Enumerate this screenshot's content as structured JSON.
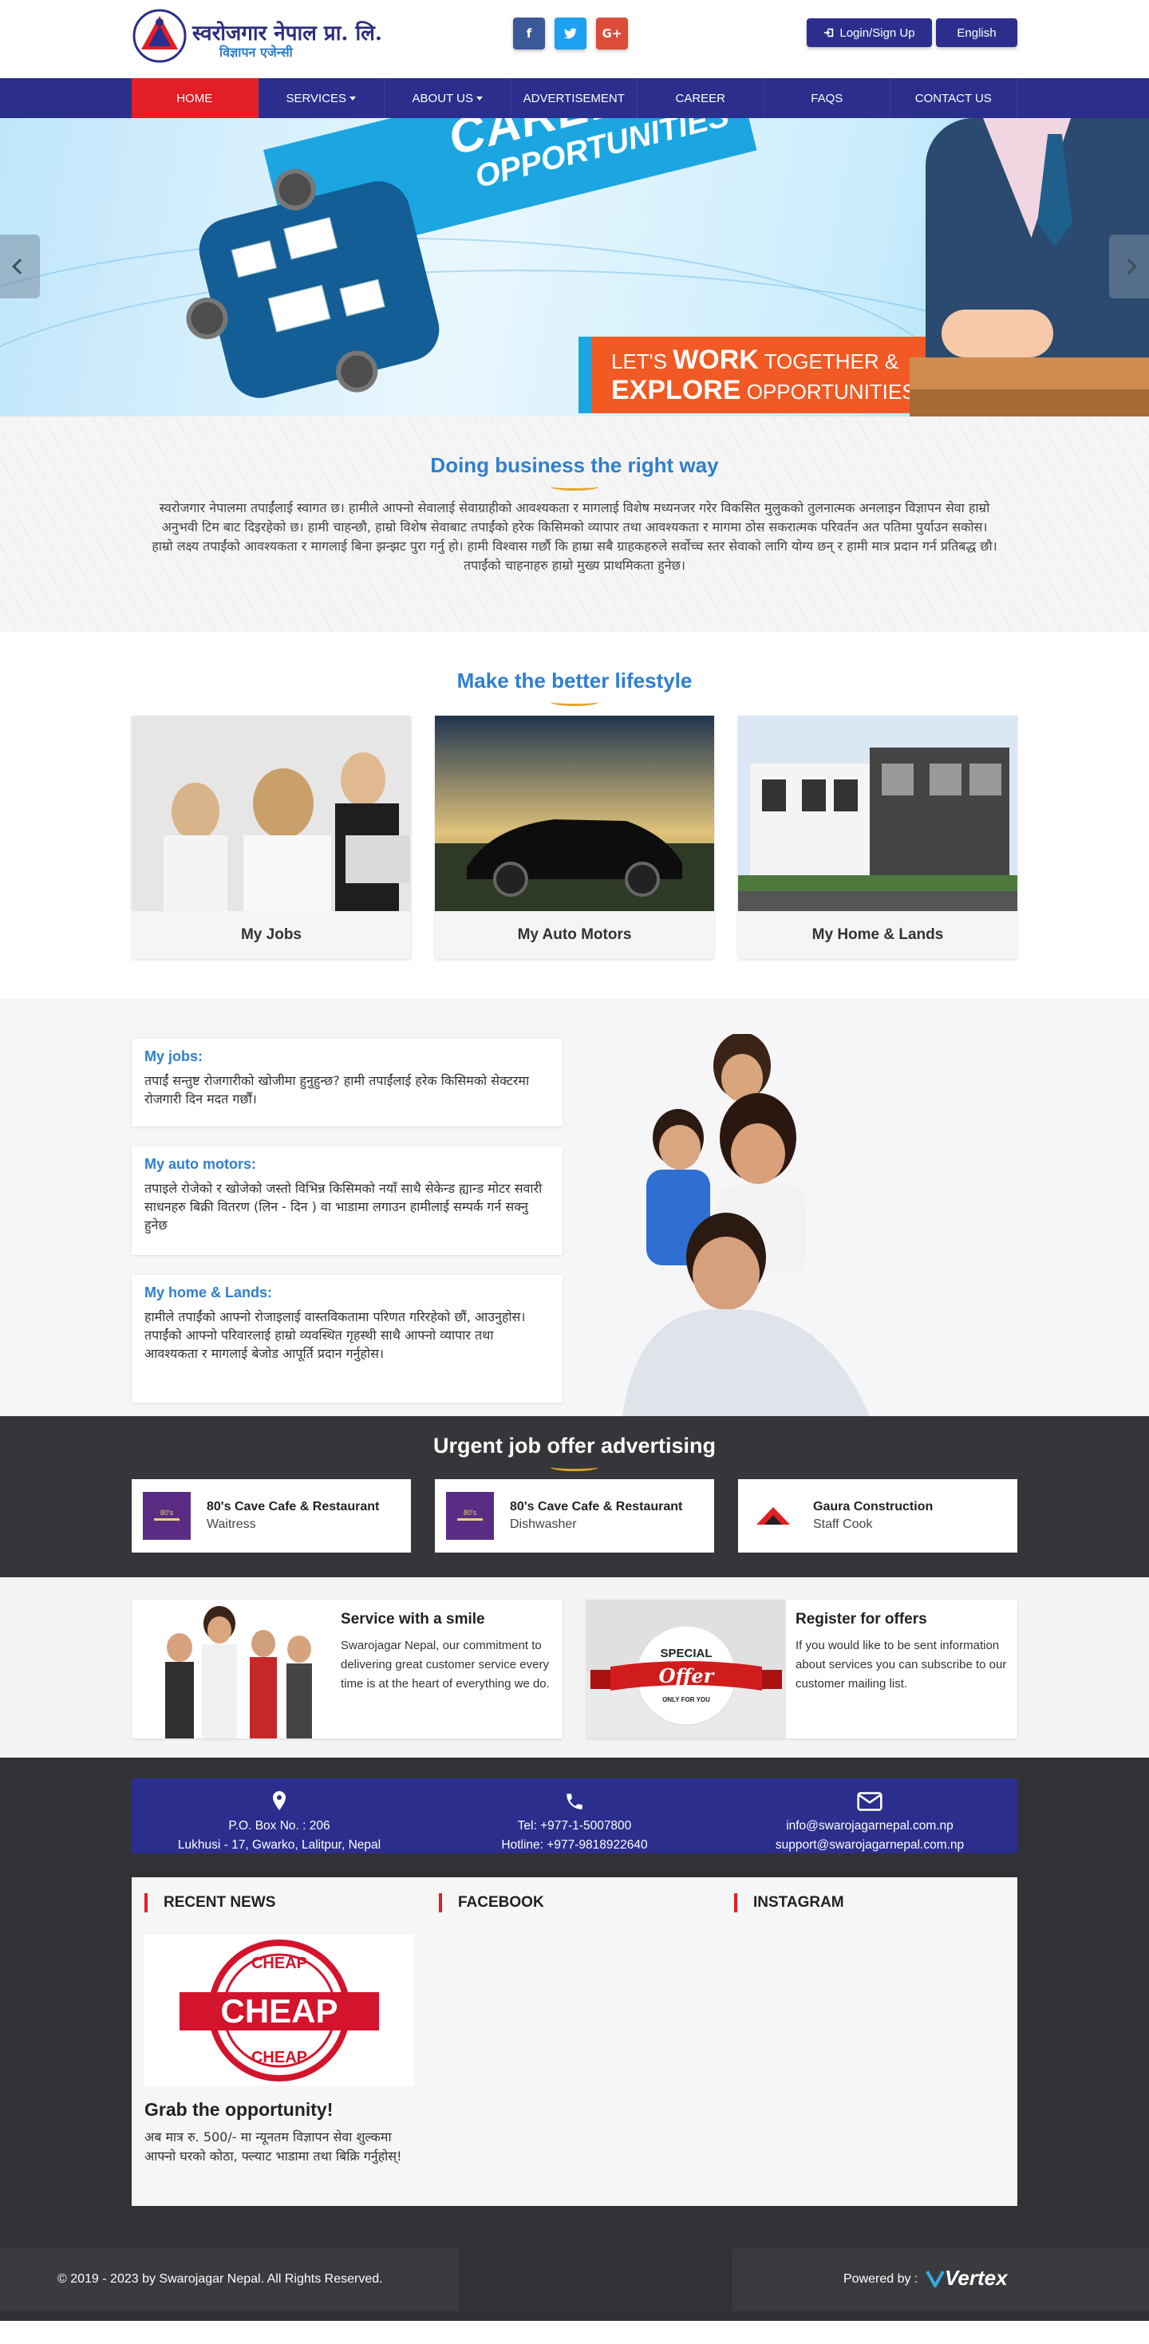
{
  "header": {
    "logo_title": "स्वरोजगार नेपाल प्रा. लि.",
    "logo_subtitle": "विज्ञापन एजेन्सी",
    "social": [
      {
        "name": "facebook",
        "glyph": "f"
      },
      {
        "name": "twitter",
        "glyph": "t"
      },
      {
        "name": "google-plus",
        "glyph": "G+"
      }
    ],
    "login_label": "Login/Sign Up",
    "language_label": "English",
    "nav": [
      {
        "label": "HOME",
        "active": true,
        "dropdown": false
      },
      {
        "label": "SERVICES",
        "active": false,
        "dropdown": true
      },
      {
        "label": "ABOUT US",
        "active": false,
        "dropdown": true
      },
      {
        "label": "ADVERTISEMENT",
        "active": false,
        "dropdown": false
      },
      {
        "label": "CAREER",
        "active": false,
        "dropdown": false
      },
      {
        "label": "FAQS",
        "active": false,
        "dropdown": false
      },
      {
        "label": "CONTACT US",
        "active": false,
        "dropdown": false
      }
    ]
  },
  "banner": {
    "line1": "CAREER",
    "line2": "OPPORTUNITIES",
    "tag1_pre": "LET'S ",
    "tag1_bold": "WORK",
    "tag1_post": " TOGETHER &",
    "tag2_bold": "EXPLORE",
    "tag2_post": " OPPORTUNITIES"
  },
  "intro": {
    "title": "Doing business the right way",
    "text": "स्वरोजगार नेपालमा तपाईंलाई स्वागत छ। हामीले आफ्नो सेवालाई सेवाग्राहीको आवश्यकता र मागलाई विशेष मध्यनजर गरेर विकसित मुलुकको तुलनात्मक अनलाइन विज्ञापन सेवा हाम्रो अनुभवी टिम बाट दिइरहेको छ। हामी चाहन्छौ, हाम्रो विशेष सेवाबाट तपाईंको हरेक किसिमको व्यापार तथा आवश्यकता र मागमा ठोस सकरात्मक परिवर्तन अत पतिमा पुर्याउन सकोस। हाम्रो लक्ष्य तपाईंको आवश्यकता र मागलाई बिना झन्झट पुरा गर्नु हो। हामी विश्वास गर्छौ कि हाम्रा सबै ग्राहकहरुले सर्वोच्च स्तर सेवाको लागि योग्य छन् र हामी मात्र प्रदान गर्न प्रतिबद्ध छौ। तपाईंको चाहनाहरु हाम्रो मुख्य प्राथमिकता हुनेछ।"
  },
  "lifestyle": {
    "title": "Make the better lifestyle",
    "cards": [
      {
        "label": "My Jobs"
      },
      {
        "label": "My Auto Motors"
      },
      {
        "label": "My Home & Lands"
      }
    ]
  },
  "info": [
    {
      "title": "My jobs:",
      "text": "तपाईं सन्तुष्ट रोजगारीको खोजीमा हुनुहुन्छ? हामी तपाईंलाई हरेक किसिमको सेक्टरमा रोजगारी दिन मदत गर्छौं।"
    },
    {
      "title": "My auto motors:",
      "text": "तपाइले रोजेको र खोजेको जस्तो विभिन्न किसिमको नयाँ साथै सेकेन्ड ह्यान्ड मोटर सवारी साधनहरु बिक्री वितरण (लिन - दिन ) वा भाडामा लगाउन हामीलाई सम्पर्क गर्न सक्नु हुनेछ"
    },
    {
      "title": "My home & Lands:",
      "text": "हामीले तपाईंको आफ्नो रोजाइलाई वास्तविकतामा परिणत गरिरहेको छौं, आउनुहोस। तपाईंको आफ्नो परिवारलाई हाम्रो व्यवस्थित गृहस्थी साथै आफ्नो व्यापार तथा आवश्यकता र मागलाई बेजोड आपूर्ति प्रदान गर्नुहोस।"
    }
  ],
  "urgent": {
    "title": "Urgent job offer advertising",
    "jobs": [
      {
        "company": "80's Cave Cafe & Restaurant",
        "position": "Waitress",
        "logo": "cafe-logo"
      },
      {
        "company": "80's Cave Cafe & Restaurant",
        "position": "Dishwasher",
        "logo": "cafe-logo"
      },
      {
        "company": "Gaura Construction",
        "position": "Staff Cook",
        "logo": "construction-logo"
      }
    ]
  },
  "promos": [
    {
      "title": "Service with a smile",
      "text": "Swarojagar Nepal, our commitment to delivering great customer service every time is at the heart of everything we do."
    },
    {
      "title": "Register for offers",
      "text": "If you would like to be sent information about services you can subscribe to our customer mailing list.",
      "badge_top": "SPECIAL",
      "badge_main": "Offer",
      "badge_bottom": "ONLY FOR YOU"
    }
  ],
  "contact": {
    "address1": "P.O. Box No. : 206",
    "address2": "Lukhusi - 17, Gwarko, Lalitpur, Nepal",
    "tel": "Tel: +977-1-5007800",
    "hotline": "Hotline: +977-9818922640",
    "email1": "info@swarojagarnepal.com.np",
    "email2": "support@swarojagarnepal.com.np"
  },
  "footer_panel": {
    "news_heading": "RECENT NEWS",
    "facebook_heading": "FACEBOOK",
    "instagram_heading": "INSTAGRAM",
    "stamp_top": "CHEAP",
    "stamp_main": "CHEAP",
    "stamp_bottom": "CHEAP",
    "news_title": "Grab the opportunity!",
    "news_text": "अब मात्र रु. 500/- मा न्यूनतम विज्ञापन सेवा शुल्कमा आफ्नो घरको कोठा, फ्ल्याट भाडामा तथा बिक्रि गर्नुहोस्!"
  },
  "bottom": {
    "copyright": "© 2019 - 2023 by Swarojagar Nepal. All Rights Reserved.",
    "powered_by": "Powered by :",
    "vendor": "Vertex"
  },
  "colors": {
    "brand": "#2b2e8c",
    "accent": "#e31e24",
    "heading": "#2d7fd1",
    "dark": "#313236"
  }
}
